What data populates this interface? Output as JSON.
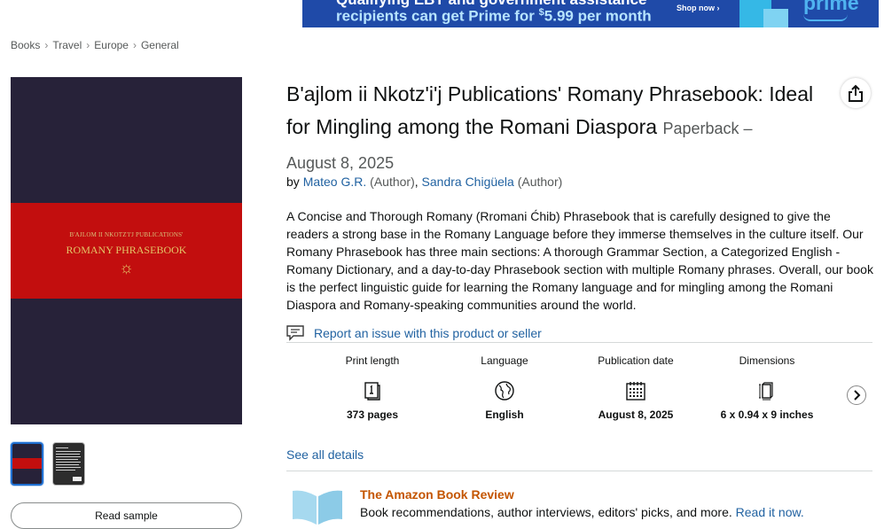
{
  "ad": {
    "line1": "Qualifying EBT and government assistance",
    "line2_prefix": "recipients can get Prime for ",
    "line2_currency": "$",
    "line2_price": "5.99 per month",
    "shop_now": "Shop now ›",
    "brand": "prime"
  },
  "breadcrumb": [
    "Books",
    "Travel",
    "Europe",
    "General"
  ],
  "cover": {
    "publisher_line": "B'AJLOM II NKOTZ'I'J PUBLICATIONS'",
    "title_line": "ROMANY PHRASEBOOK",
    "emblem": "☼"
  },
  "read_sample": "Read sample",
  "product": {
    "title": "B'ajlom ii Nkotz'i'j Publications' Romany Phrasebook: Ideal for Mingling among the Romani Diaspora",
    "format": "Paperback",
    "dash": "–",
    "date": "August 8, 2025",
    "by": "by",
    "authors": [
      {
        "name": "Mateo G.R.",
        "role": "(Author)",
        "sep": ","
      },
      {
        "name": "Sandra Chigüela",
        "role": "(Author)",
        "sep": ""
      }
    ]
  },
  "description": "A Concise and Thorough Romany (Rromani Ćhib) Phrasebook that is carefully designed to give the readers a strong base in the Romany Language before they immerse themselves in the culture itself. Our Romany Phrasebook has three main sections: A thorough Grammar Section, a Categorized English - Romany Dictionary, and a day-to-day Phrasebook section with multiple Romany phrases. Overall, our book is the perfect linguistic guide for learning the Romany language and for mingling among the Romani Diaspora and Romany-speaking communities around the world.",
  "report_link": "Report an issue with this product or seller",
  "details": [
    {
      "label": "Print length",
      "value": "373 pages",
      "icon": "book-pages-icon"
    },
    {
      "label": "Language",
      "value": "English",
      "icon": "globe-icon"
    },
    {
      "label": "Publication date",
      "value": "August 8, 2025",
      "icon": "calendar-icon"
    },
    {
      "label": "Dimensions",
      "value": "6 x 0.94 x 9 inches",
      "icon": "dimensions-icon"
    }
  ],
  "see_all": "See all details",
  "review": {
    "title": "The Amazon Book Review",
    "text": "Book recommendations, author interviews, editors' picks, and more.",
    "link": "Read it now."
  },
  "colors": {
    "link": "#2162a1",
    "cover_bg": "#272239",
    "cover_band": "#c20e0e",
    "review_title": "#c45500"
  }
}
